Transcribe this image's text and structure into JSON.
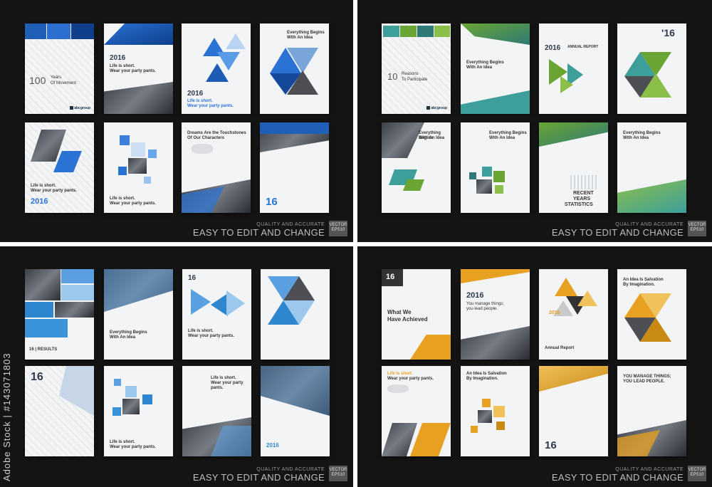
{
  "footer": {
    "tagline": "QUALITY AND ACCURATE",
    "headline": "EASY TO EDIT AND CHANGE",
    "badge": "VECTOR EPS10"
  },
  "watermark": "Adobe Stock | #143071803",
  "colors": {
    "background": "#141414",
    "blue": "#2a72d4",
    "green": "#6aa533",
    "orange": "#e8a020",
    "lightblue": "#5aa0e0"
  },
  "logo": "abcgroup",
  "top_left": {
    "c1": {
      "n1": "100",
      "t1": "Years",
      "t2": "Of Movement"
    },
    "c2": {
      "year": "2016",
      "line1": "Life is short.",
      "line2": "Wear your party pants."
    },
    "c3": {
      "year": "2016",
      "line1": "Life is short.",
      "line2": "Wear your party pants."
    },
    "c4": {
      "line1": "Everything Begins",
      "line2": "With An Idea"
    },
    "c5": {
      "line1": "Life is short.",
      "line2": "Wear your party pants.",
      "year": "2016"
    },
    "c6": {
      "line1": "Life is short.",
      "line2": "Wear your party pants."
    },
    "c7": {
      "line1": "Dreams Are the Touchstones",
      "line2": "Of Our Characters"
    },
    "c8": {
      "year": "16"
    }
  },
  "top_right": {
    "c1": {
      "n1": "10",
      "t1": "Reasons",
      "t2": "To Participate"
    },
    "c2": {
      "line1": "Everything Begins",
      "line2": "With An Idea"
    },
    "c3": {
      "year": "2016",
      "label": "ANNUAL REPORT"
    },
    "c4": {
      "year": "'16"
    },
    "c5": {
      "line1": "Everything Begins",
      "line2": "With An Idea"
    },
    "c6": {
      "line1": "Everything Begins",
      "line2": "With An Idea"
    },
    "c7": {
      "line1": "RECENT",
      "line2": "YEARS",
      "line3": "STATISTICS"
    },
    "c8": {
      "line1": "Everything Begins",
      "line2": "With An Idea"
    }
  },
  "bottom_left": {
    "c1": {
      "label": "16 | RESULTS"
    },
    "c2": {
      "line1": "Everything Begins",
      "line2": "With An Idea"
    },
    "c3": {
      "year": "16",
      "line1": "Life is short.",
      "line2": "Wear your party pants."
    },
    "c5": {
      "year": "16"
    },
    "c6": {
      "line1": "Life is short.",
      "line2": "Wear your party pants."
    },
    "c7": {
      "line1": "Life is short.",
      "line2": "Wear your party pants."
    },
    "c8": {
      "year": "2016"
    }
  },
  "bottom_right": {
    "c1": {
      "year": "16",
      "line1": "What We",
      "line2": "Have Achieved"
    },
    "c2": {
      "year": "2016",
      "line1": "You manage things;",
      "line2": "you lead people."
    },
    "c3": {
      "year": "2016",
      "label": "Annual Report"
    },
    "c4": {
      "line1": "An Idea Is Salvation",
      "line2": "By Imagination."
    },
    "c5": {
      "line1": "Life is short.",
      "line2": "Wear your party pants."
    },
    "c6": {
      "line1": "An Idea Is Salvation",
      "line2": "By Imagination."
    },
    "c7": {
      "year": "16"
    },
    "c8": {
      "line1": "YOU MANAGE THINGS;",
      "line2": "YOU LEAD PEOPLE."
    }
  }
}
